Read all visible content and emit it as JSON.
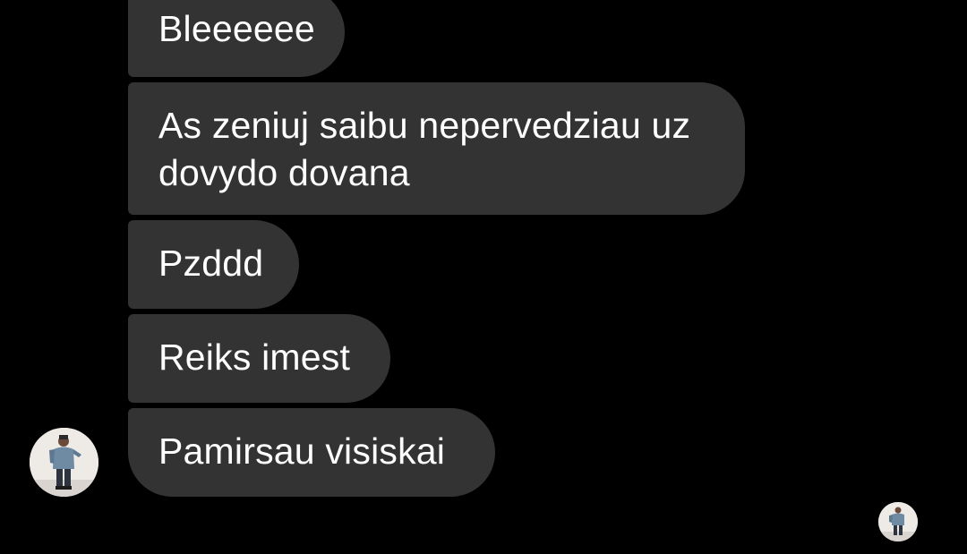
{
  "messages": [
    {
      "text": "Bleeeeee"
    },
    {
      "text": "As zeniuj saibu nepervedziau uz dovydo dovana"
    },
    {
      "text": "Pzddd"
    },
    {
      "text": "Reiks imest"
    },
    {
      "text": "Pamirsau visiskai"
    }
  ],
  "colors": {
    "background": "#000000",
    "bubble": "#333333",
    "text": "#ffffff"
  },
  "icons": {
    "sender_avatar": "profile-photo",
    "read_receipt": "profile-photo-small"
  }
}
